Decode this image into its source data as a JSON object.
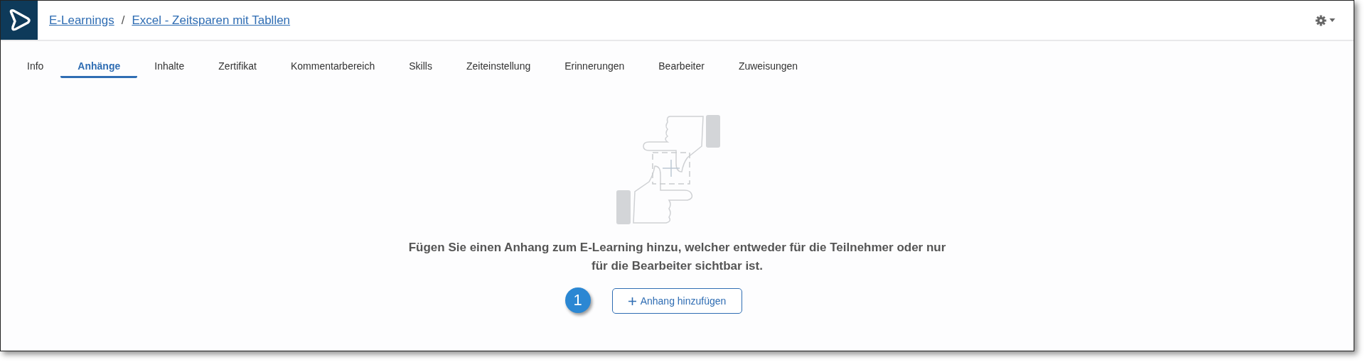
{
  "breadcrumb": [
    {
      "label": "E-Learnings"
    },
    {
      "label": "Excel - Zeitsparen mit Tabllen"
    }
  ],
  "breadcrumb_separator": "/",
  "tabs": [
    {
      "label": "Info",
      "selected": false
    },
    {
      "label": "Anhänge",
      "selected": true
    },
    {
      "label": "Inhalte",
      "selected": false
    },
    {
      "label": "Zertifikat",
      "selected": false
    },
    {
      "label": "Kommentarbereich",
      "selected": false
    },
    {
      "label": "Skills",
      "selected": false
    },
    {
      "label": "Zeiteinstellung",
      "selected": false
    },
    {
      "label": "Erinnerungen",
      "selected": false
    },
    {
      "label": "Bearbeiter",
      "selected": false
    },
    {
      "label": "Zuweisungen",
      "selected": false
    }
  ],
  "empty_state": {
    "message": "Fügen Sie einen Anhang zum E-Learning hinzu, welcher entweder für die Teilnehmer oder nur für die Bearbeiter sichtbar ist.",
    "button": "Anhang hinzufügen",
    "callout": "1"
  }
}
